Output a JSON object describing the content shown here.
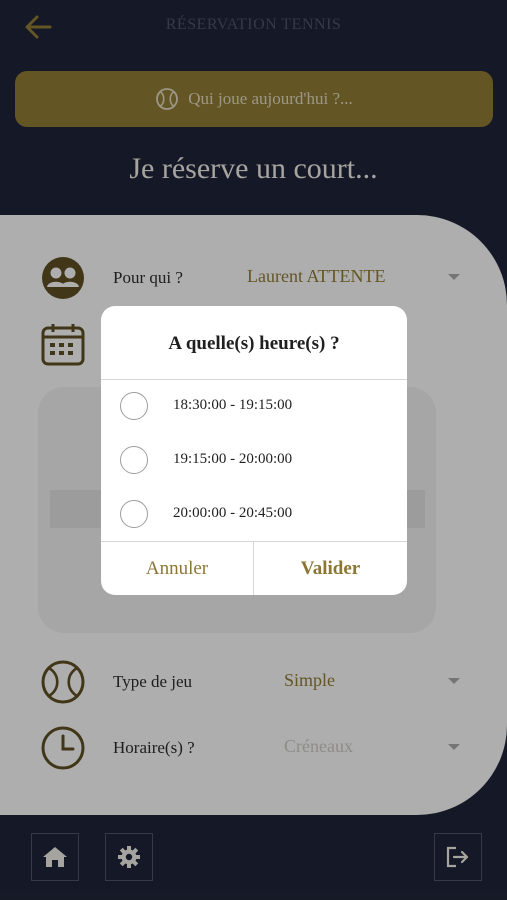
{
  "header": {
    "title": "RÉSERVATION TENNIS",
    "back_icon": "arrow-left-icon"
  },
  "who_plays": {
    "label": "Qui joue aujourd'hui ?...",
    "icon": "tennis-ball-icon"
  },
  "page_title": "Je réserve un court...",
  "form": {
    "for_whom": {
      "label": "Pour qui ?",
      "value": "Laurent ATTENTE",
      "icon": "people-icon"
    },
    "date": {
      "icon": "calendar-icon"
    },
    "game_type": {
      "label": "Type de jeu",
      "value": "Simple",
      "icon": "tennis-ball-icon"
    },
    "time_slots": {
      "label": "Horaire(s) ?",
      "placeholder": "Créneaux",
      "icon": "clock-icon"
    }
  },
  "dialog": {
    "title": "A quelle(s) heure(s) ?",
    "slots": [
      "18:30:00 - 19:15:00",
      "19:15:00 - 20:00:00",
      "20:00:00 - 20:45:00"
    ],
    "cancel_label": "Annuler",
    "confirm_label": "Valider"
  },
  "bottom_nav": {
    "home_icon": "home-icon",
    "settings_icon": "gear-icon",
    "logout_icon": "logout-icon"
  },
  "colors": {
    "background": "#1e2235",
    "accent": "#8b7633",
    "card": "#f2f2f2"
  }
}
